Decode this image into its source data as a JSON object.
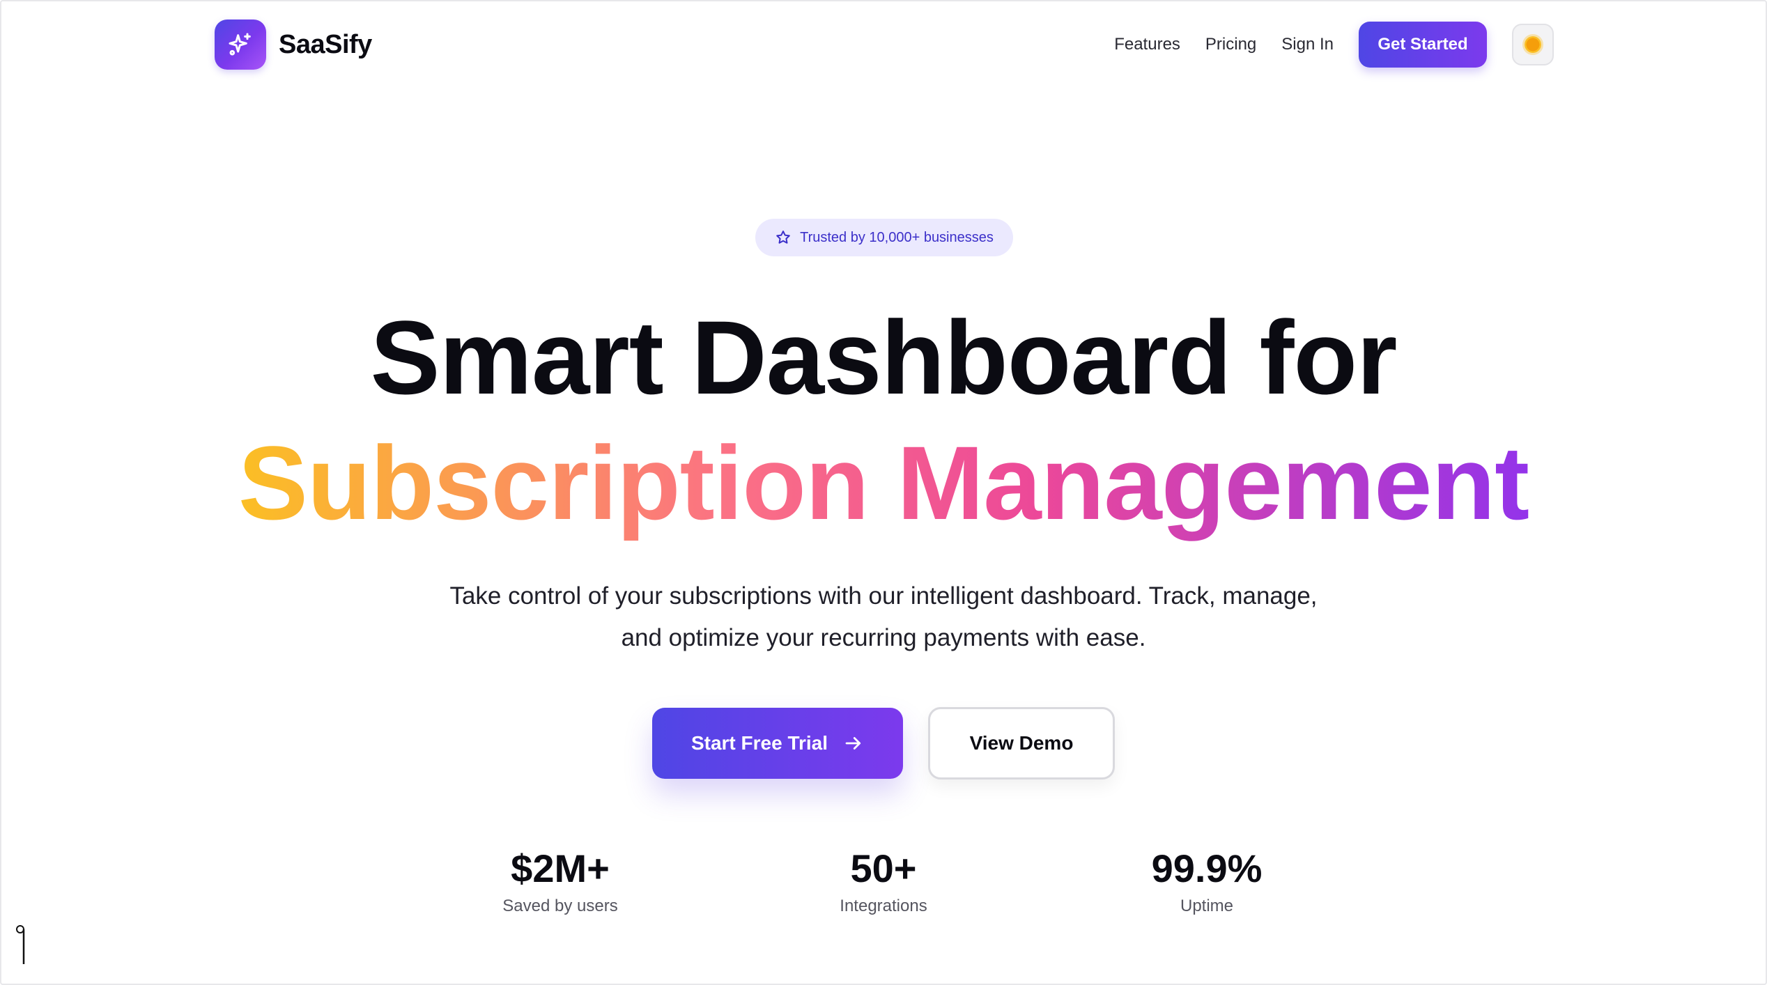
{
  "header": {
    "brand": "SaaSify",
    "nav": [
      "Features",
      "Pricing",
      "Sign In"
    ],
    "cta": "Get Started",
    "theme_toggle_icon": "sun-icon"
  },
  "hero": {
    "badge": "Trusted by 10,000+ businesses",
    "title_line1": "Smart Dashboard for",
    "title_line2": "Subscription Management",
    "subtitle_line1": "Take control of your subscriptions with our intelligent dashboard. Track, manage,",
    "subtitle_line2": "and optimize your recurring payments with ease.",
    "primary_button": "Start Free Trial",
    "secondary_button": "View Demo"
  },
  "stats": [
    {
      "value": "$2M+",
      "label": "Saved by users"
    },
    {
      "value": "50+",
      "label": "Integrations"
    },
    {
      "value": "99.9%",
      "label": "Uptime"
    }
  ],
  "colors": {
    "brand_primary": "#4f46e5",
    "brand_secondary": "#7c3aed",
    "gradient_start": "#fbbf24",
    "gradient_mid": "#ec4899",
    "gradient_end": "#9333ea",
    "badge_bg": "#ebe9fe"
  }
}
